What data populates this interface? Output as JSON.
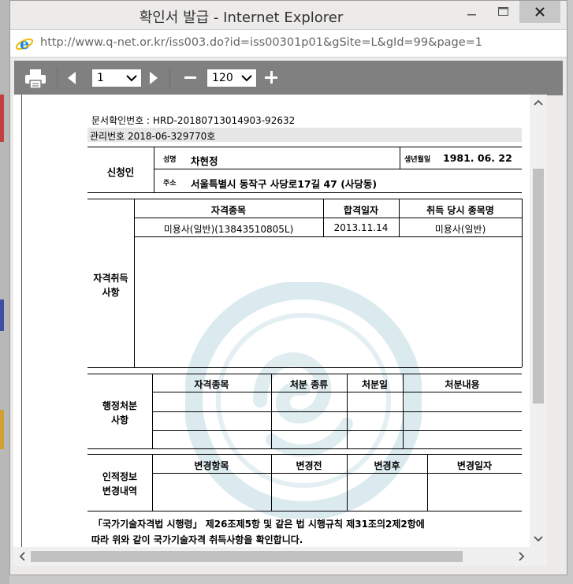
{
  "window": {
    "title": "확인서 발급 - Internet Explorer",
    "url": "http://www.q-net.or.kr/iss003.do?id=iss00301p01&gSite=L&gId=99&page=1"
  },
  "toolbar": {
    "page_value": "1",
    "zoom_value": "120"
  },
  "doc": {
    "doc_number": "문서확인번호 : HRD-20180713014903-92632",
    "mgmt_number": "관리번호 2018-06-329770호",
    "applicant": {
      "section_label": "신청인",
      "name_label": "성명",
      "name": "차현정",
      "dob_label": "생년월일",
      "dob": "1981. 06. 22",
      "address_label": "주소",
      "address": "서울특별시 동작구 사당로17길 47 (사당동)"
    },
    "qualification": {
      "section_label_1": "자격취득",
      "section_label_2": "사항",
      "headers": [
        "자격종목",
        "합격일자",
        "취득 당시 종목명"
      ],
      "rows": [
        [
          "미용사(일반)(13843510805L)",
          "2013.11.14",
          "미용사(일반)"
        ]
      ]
    },
    "admin": {
      "section_label_1": "행정처분",
      "section_label_2": "사항",
      "headers": [
        "자격종목",
        "처분 종류",
        "처분일",
        "처분내용"
      ]
    },
    "personal": {
      "section_label_1": "인적정보",
      "section_label_2": "변경내역",
      "headers": [
        "변경항목",
        "변경전",
        "변경후",
        "변경일자"
      ]
    },
    "footer_line1": "「국가기술자격법 시행령」 제26조제5항 및 같은 법 시행규칙 제31조의2제2항에",
    "footer_line2": "따라 위와 같이 국가기술자격 취득사항을 확인합니다."
  },
  "colors": {
    "toolbar_bg": "#808080",
    "watermark": "#7fb5c4",
    "close_button": "#c7c7c7"
  },
  "icons": [
    "internet-explorer-icon",
    "print-icon",
    "prev-page-icon",
    "next-page-icon",
    "zoom-out-icon",
    "zoom-in-icon",
    "chevron-down-icon"
  ]
}
